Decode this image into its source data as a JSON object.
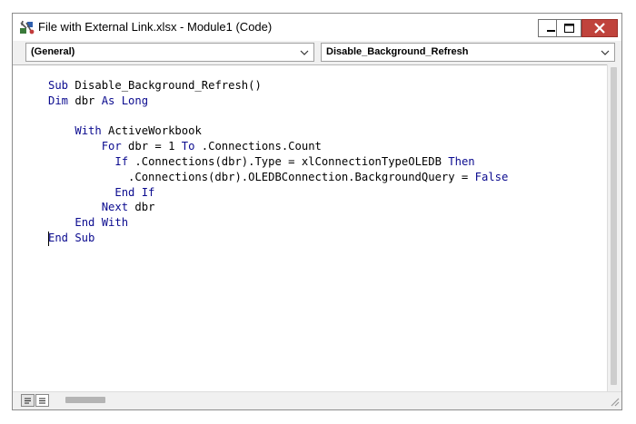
{
  "window": {
    "title": "File with External Link.xlsx - Module1 (Code)",
    "controls": [
      "minimize",
      "maximize",
      "close"
    ],
    "close_color": "#c0433c"
  },
  "selectors": {
    "object": "(General)",
    "procedure": "Disable_Background_Refresh"
  },
  "code": {
    "lines": [
      [
        {
          "t": "Sub",
          "k": true
        },
        {
          "t": " Disable_Background_Refresh()",
          "k": false
        }
      ],
      [
        {
          "t": "Dim",
          "k": true
        },
        {
          "t": " dbr ",
          "k": false
        },
        {
          "t": "As Long",
          "k": true
        }
      ],
      [],
      [
        {
          "t": "    ",
          "k": false
        },
        {
          "t": "With",
          "k": true
        },
        {
          "t": " ActiveWorkbook",
          "k": false
        }
      ],
      [
        {
          "t": "        ",
          "k": false
        },
        {
          "t": "For",
          "k": true
        },
        {
          "t": " dbr = 1 ",
          "k": false
        },
        {
          "t": "To",
          "k": true
        },
        {
          "t": " .Connections.Count",
          "k": false
        }
      ],
      [
        {
          "t": "          ",
          "k": false
        },
        {
          "t": "If",
          "k": true
        },
        {
          "t": " .Connections(dbr).Type = xlConnectionTypeOLEDB ",
          "k": false
        },
        {
          "t": "Then",
          "k": true
        }
      ],
      [
        {
          "t": "            .Connections(dbr).OLEDBConnection.BackgroundQuery = ",
          "k": false
        },
        {
          "t": "False",
          "k": true
        }
      ],
      [
        {
          "t": "          ",
          "k": false
        },
        {
          "t": "End If",
          "k": true
        }
      ],
      [
        {
          "t": "        ",
          "k": false
        },
        {
          "t": "Next",
          "k": true
        },
        {
          "t": " dbr",
          "k": false
        }
      ],
      [
        {
          "t": "    ",
          "k": false
        },
        {
          "t": "End With",
          "k": true
        }
      ],
      [
        {
          "t": "End Sub",
          "k": true
        }
      ]
    ],
    "keyword_color": "#0b0b8f"
  },
  "statusbar": {
    "view_buttons": [
      "procedure-view",
      "full-module-view"
    ]
  },
  "icons": {
    "app": "vba-editor-icon",
    "dropdown": "chevron-down-icon"
  }
}
